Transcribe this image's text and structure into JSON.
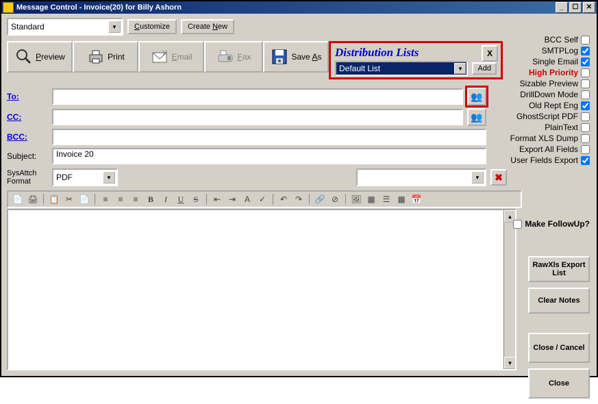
{
  "window": {
    "title": "Message Control - Invoice(20) for Billy Ashorn"
  },
  "topbar": {
    "preset": "Standard",
    "customize": "Customize",
    "createnew": "Create New"
  },
  "toolbar": {
    "preview": "Preview",
    "print": "Print",
    "email": "Email",
    "fax": "Fax",
    "saveas": "Save As"
  },
  "distribution": {
    "title": "Distribution Lists",
    "close": "X",
    "selected": "Default List",
    "add": "Add"
  },
  "checks": {
    "bccself": {
      "label": "BCC Self",
      "checked": false
    },
    "smtplog": {
      "label": "SMTPLog",
      "checked": true
    },
    "singleemail": {
      "label": "Single Email",
      "checked": true
    },
    "highpriority": {
      "label": "High Priority",
      "checked": false
    },
    "sizable": {
      "label": "Sizable Preview",
      "checked": false
    },
    "drilldown": {
      "label": "DrillDown Mode",
      "checked": false
    },
    "oldrept": {
      "label": "Old Rept Eng",
      "checked": true
    },
    "ghostscript": {
      "label": "GhostScript PDF",
      "checked": false
    },
    "plaintext": {
      "label": "PlainText",
      "checked": false
    },
    "formatxls": {
      "label": "Format XLS Dump",
      "checked": false
    },
    "exportall": {
      "label": "Export All Fields",
      "checked": false
    },
    "userfields": {
      "label": "User Fields Export",
      "checked": true
    }
  },
  "fields": {
    "to_label": "To:",
    "to_value": "",
    "cc_label": "CC:",
    "cc_value": "",
    "bcc_label": "BCC:",
    "bcc_value": "",
    "subject_label": "Subject:",
    "subject_value": "Invoice 20",
    "sysattach_label": "SysAttch Format",
    "sysattach_value": "PDF"
  },
  "right": {
    "followup": "Make FollowUp?",
    "rawxls": "RawXls Export List",
    "clearnotes": "Clear Notes",
    "closecancel": "Close / Cancel",
    "close": "Close"
  },
  "editorbuttons": [
    "new",
    "print",
    "",
    "copy",
    "cut",
    "paste",
    "",
    "left",
    "center",
    "right",
    "bold",
    "italic",
    "underline",
    "strike",
    "",
    "indent-",
    "indent+",
    "font",
    "spell",
    "",
    "undo",
    "redo",
    "",
    "link",
    "unlink",
    "",
    "img",
    "color",
    "list",
    "table",
    "date"
  ]
}
